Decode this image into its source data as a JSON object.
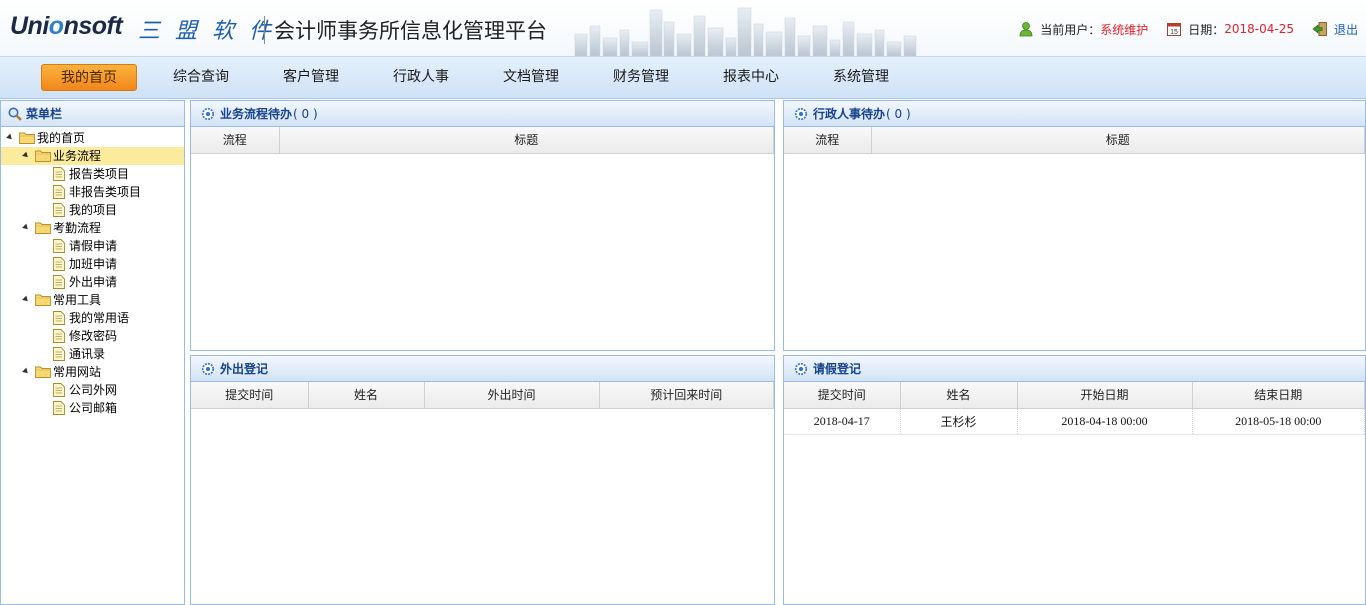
{
  "header": {
    "logo_text_a": "Uni",
    "logo_text_b": "o",
    "logo_text_c": "nsoft",
    "logo_cn": "三 盟 软 件",
    "platform_title": "会计师事务所信息化管理平台",
    "current_user_label": "当前用户：",
    "current_user": "系统维护",
    "date_label": "日期：",
    "date": "2018-04-25",
    "logout": "退出"
  },
  "nav": {
    "items": [
      "我的首页",
      "综合查询",
      "客户管理",
      "行政人事",
      "文档管理",
      "财务管理",
      "报表中心",
      "系统管理"
    ],
    "active_index": 0
  },
  "sidebar": {
    "title": "菜单栏",
    "tree": {
      "root": "我的首页",
      "groups": [
        {
          "label": "业务流程",
          "children": [
            "报告类项目",
            "非报告类项目",
            "我的项目"
          ]
        },
        {
          "label": "考勤流程",
          "children": [
            "请假申请",
            "加班申请",
            "外出申请"
          ]
        },
        {
          "label": "常用工具",
          "children": [
            "我的常用语",
            "修改密码",
            "通讯录"
          ]
        },
        {
          "label": "常用网站",
          "children": [
            "公司外网",
            "公司邮箱"
          ]
        }
      ]
    }
  },
  "panels": {
    "business": {
      "title": "业务流程待办",
      "count": "( 0 )",
      "columns": [
        "流程",
        "标题"
      ]
    },
    "admin": {
      "title": "行政人事待办",
      "count": "( 0 )",
      "columns": [
        "流程",
        "标题"
      ]
    },
    "outing": {
      "title": "外出登记",
      "columns": [
        "提交时间",
        "姓名",
        "外出时间",
        "预计回来时间"
      ]
    },
    "leave": {
      "title": "请假登记",
      "columns": [
        "提交时间",
        "姓名",
        "开始日期",
        "结束日期"
      ],
      "rows": [
        [
          "2018-04-17",
          "王杉杉",
          "2018-04-18 00:00",
          "2018-05-18 00:00"
        ]
      ]
    }
  },
  "colors": {
    "accent_red": "#e0202a",
    "link_blue": "#1a5fb8",
    "nav_active": "#f2861a",
    "panel_title": "#15428b"
  }
}
